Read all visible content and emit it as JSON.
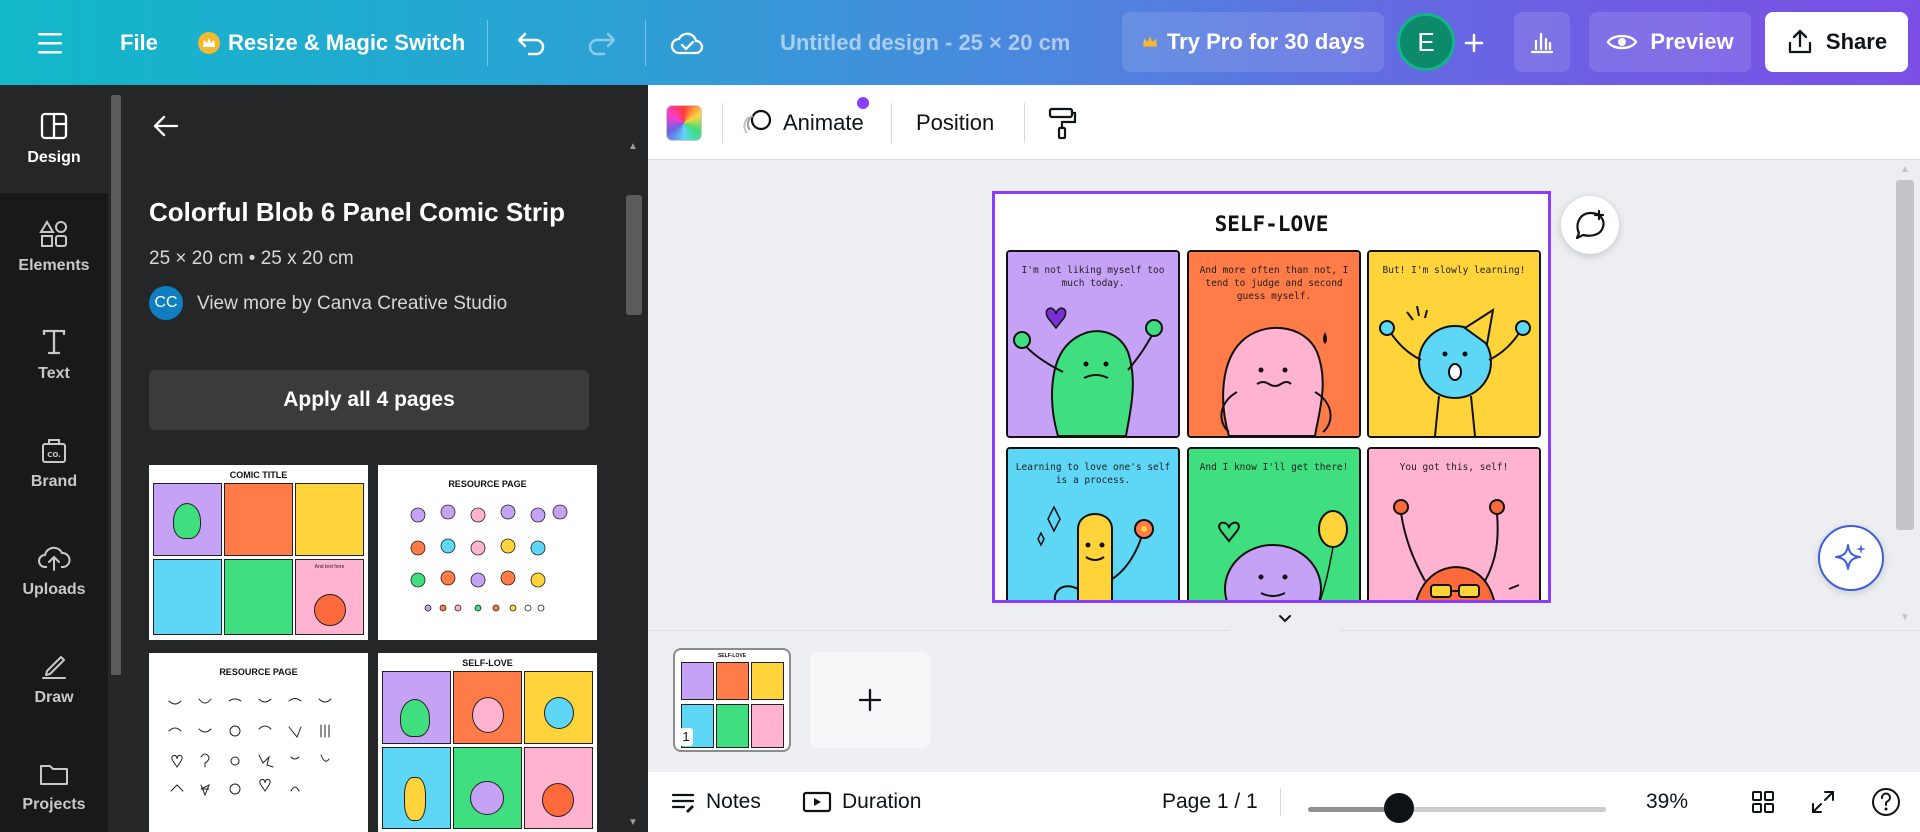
{
  "topbar": {
    "menu_icon": "hamburger-icon",
    "file_label": "File",
    "resize_label": "Resize & Magic Switch",
    "resize_icon": "crown-icon",
    "undo_icon": "undo-icon",
    "redo_icon": "redo-icon",
    "cloud_icon": "cloud-check-icon",
    "doc_title": "Untitled design - 25 × 20 cm",
    "pro_label": "Try Pro for 30 days",
    "pro_icon": "crown-icon",
    "avatar_initial": "E",
    "share_label": "Share",
    "preview_label": "Preview",
    "colors": {
      "crown": "#f5b92f",
      "avatar": "#0c8a6a"
    }
  },
  "rail": {
    "items": [
      {
        "label": "Design",
        "icon": "layout-icon"
      },
      {
        "label": "Elements",
        "icon": "shapes-icon"
      },
      {
        "label": "Text",
        "icon": "text-icon"
      },
      {
        "label": "Brand",
        "icon": "brand-kit-icon"
      },
      {
        "label": "Uploads",
        "icon": "cloud-upload-icon"
      },
      {
        "label": "Draw",
        "icon": "pen-icon"
      },
      {
        "label": "Projects",
        "icon": "folder-icon"
      }
    ]
  },
  "panel": {
    "title": "Colorful Blob 6 Panel Comic Strip",
    "size_line": "25 × 20 cm • 25 x 20 cm",
    "creator_initials": "CC",
    "creator_link": "View more by Canva Creative Studio",
    "apply_label": "Apply all 4 pages",
    "thumbs": [
      {
        "title": "COMIC TITLE",
        "caption": "And text here"
      },
      {
        "title": "RESOURCE PAGE"
      },
      {
        "title": "RESOURCE PAGE"
      },
      {
        "title": "SELF-LOVE"
      }
    ]
  },
  "context_bar": {
    "animate_label": "Animate",
    "position_label": "Position",
    "color_icon": "rainbow-color-icon",
    "animate_icon": "animate-icon",
    "paint_icon": "paint-roller-icon"
  },
  "page": {
    "heading": "SELF-LOVE",
    "panels": [
      {
        "caption": "I'm not liking myself too much today.",
        "bg": "#c6a2f7"
      },
      {
        "caption": "And more often than not, I tend to judge and second guess myself.",
        "bg": "#ff7b47"
      },
      {
        "caption": "But! I'm slowly learning!",
        "bg": "#ffd43b"
      },
      {
        "caption": "Learning to love one's self is a process.",
        "bg": "#5ed6f5"
      },
      {
        "caption": "And I know I'll get there!",
        "bg": "#3fde7e"
      },
      {
        "caption": "You got this, self!",
        "bg": "#ffb3d1"
      }
    ]
  },
  "strip": {
    "page_number": "1",
    "add_icon": "plus-icon"
  },
  "footer": {
    "notes_label": "Notes",
    "duration_label": "Duration",
    "page_indicator": "Page 1 / 1",
    "zoom_label": "39%",
    "zoom_value": 0.39
  }
}
